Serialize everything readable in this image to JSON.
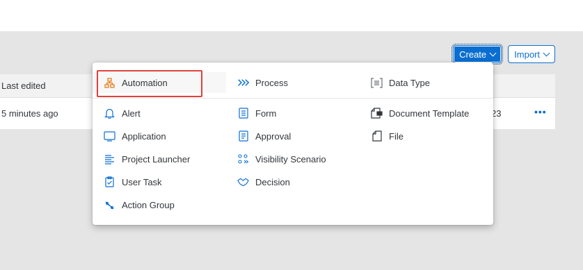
{
  "toolbar": {
    "create_label": "Create",
    "import_label": "Import"
  },
  "table": {
    "header_edited": "Last edited",
    "row": {
      "edited": "5 minutes ago",
      "version_fragment": "23",
      "more": "•••"
    }
  },
  "menu": {
    "top_items": [
      {
        "label": "Automation",
        "icon": "automation-icon",
        "icon_color": "#e9730c"
      },
      {
        "label": "Process",
        "icon": "process-icon",
        "icon_color": "#0a6ed1"
      },
      {
        "label": "Data Type",
        "icon": "data-type-icon",
        "icon_color": "#6a6d70"
      }
    ],
    "col1": [
      "Alert",
      "Application",
      "Project Launcher",
      "User Task",
      "Action Group"
    ],
    "col2": [
      "Form",
      "Approval",
      "Visibility Scenario",
      "Decision"
    ],
    "col3": [
      "Document Template",
      "File"
    ]
  },
  "colors": {
    "brand": "#0a6ed1",
    "background": "#e5e5e5",
    "highlight_frame": "#e0403a"
  }
}
